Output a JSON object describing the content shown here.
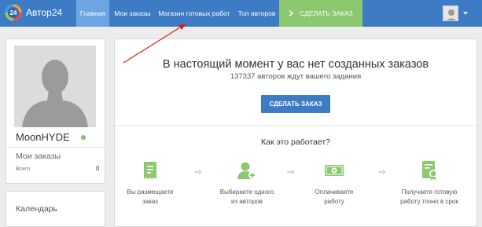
{
  "header": {
    "logo_number": "24",
    "brand": "Автор24",
    "nav": [
      {
        "label": "Главная",
        "active": true
      },
      {
        "label": "Мои заказы",
        "active": false
      },
      {
        "label": "Магазин готовых работ",
        "active": false
      },
      {
        "label": "Топ авторов",
        "active": false
      }
    ],
    "order_button": "СДЕЛАТЬ ЗАКАЗ",
    "order_icon": "chevron-right-icon",
    "user_menu_icon": "avatar-icon"
  },
  "profile": {
    "username": "MoonHYDE",
    "online": true,
    "my_orders_label": "Мои заказы",
    "total_label": "Всего",
    "total_count": "0"
  },
  "calendar": {
    "label": "Календарь"
  },
  "main": {
    "headline": "В настоящий момент у вас нет созданных заказов",
    "subline": "137337 авторов ждут вашего задания",
    "cta": "СДЕЛАТЬ ЗАКАЗ",
    "how_title": "Как это работает?",
    "steps": [
      {
        "icon": "receipt-icon",
        "line1": "Вы размещаете",
        "line2": "заказ"
      },
      {
        "icon": "add-user-icon",
        "line1": "Выбираете одного",
        "line2": "из авторов"
      },
      {
        "icon": "money-icon",
        "line1": "Оплачиваете",
        "line2": "работу"
      },
      {
        "icon": "certificate-icon",
        "line1": "Получаете готовую",
        "line2": "работу точно в срок"
      }
    ]
  },
  "colors": {
    "topbar": "#3d7bc4",
    "active_tab": "#6ca5e2",
    "order_button": "#8bc86f",
    "icon_green": "#8bc86f",
    "annotation_arrow": "#e0201b"
  }
}
